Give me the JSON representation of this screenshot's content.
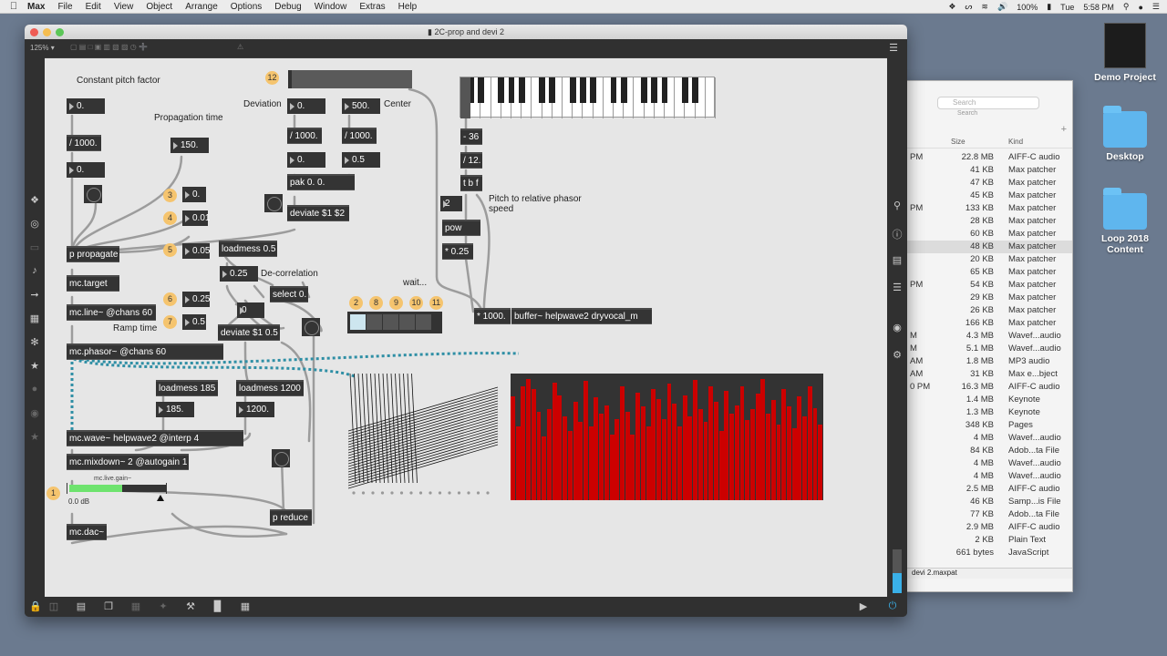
{
  "menubar": {
    "app": "Max",
    "items": [
      "File",
      "Edit",
      "View",
      "Object",
      "Arrange",
      "Options",
      "Debug",
      "Window",
      "Extras",
      "Help"
    ],
    "battery": "100%",
    "day": "Tue",
    "time": "5:58 PM"
  },
  "desktop": {
    "icons": [
      {
        "label": "Demo Project",
        "icon": "project-icon"
      },
      {
        "label": "Desktop",
        "icon": "folder-icon"
      },
      {
        "label": "Loop 2018 Content",
        "icon": "folder-icon"
      }
    ]
  },
  "finder": {
    "search_placeholder": "Search",
    "search_label": "Search",
    "columns": {
      "size": "Size",
      "kind": "Kind"
    },
    "rows": [
      {
        "date": "PM",
        "size": "22.8 MB",
        "kind": "AIFF-C audio"
      },
      {
        "date": "",
        "size": "41 KB",
        "kind": "Max patcher"
      },
      {
        "date": "",
        "size": "47 KB",
        "kind": "Max patcher"
      },
      {
        "date": "",
        "size": "45 KB",
        "kind": "Max patcher"
      },
      {
        "date": "PM",
        "size": "133 KB",
        "kind": "Max patcher"
      },
      {
        "date": "",
        "size": "28 KB",
        "kind": "Max patcher"
      },
      {
        "date": "",
        "size": "60 KB",
        "kind": "Max patcher"
      },
      {
        "date": "",
        "size": "48 KB",
        "kind": "Max patcher"
      },
      {
        "date": "",
        "size": "20 KB",
        "kind": "Max patcher"
      },
      {
        "date": "",
        "size": "65 KB",
        "kind": "Max patcher"
      },
      {
        "date": "PM",
        "size": "54 KB",
        "kind": "Max patcher"
      },
      {
        "date": "",
        "size": "29 KB",
        "kind": "Max patcher"
      },
      {
        "date": "",
        "size": "26 KB",
        "kind": "Max patcher"
      },
      {
        "date": "",
        "size": "166 KB",
        "kind": "Max patcher"
      },
      {
        "date": "M",
        "size": "4.3 MB",
        "kind": "Wavef...audio"
      },
      {
        "date": "M",
        "size": "5.1 MB",
        "kind": "Wavef...audio"
      },
      {
        "date": "AM",
        "size": "1.8 MB",
        "kind": "MP3 audio"
      },
      {
        "date": "AM",
        "size": "31 KB",
        "kind": "Max e...bject"
      },
      {
        "date": "0 PM",
        "size": "16.3 MB",
        "kind": "AIFF-C audio"
      },
      {
        "date": "",
        "size": "1.4 MB",
        "kind": "Keynote"
      },
      {
        "date": "",
        "size": "1.3 MB",
        "kind": "Keynote"
      },
      {
        "date": "",
        "size": "348 KB",
        "kind": "Pages"
      },
      {
        "date": "",
        "size": "4 MB",
        "kind": "Wavef...audio"
      },
      {
        "date": "",
        "size": "84 KB",
        "kind": "Adob...ta File"
      },
      {
        "date": "",
        "size": "4 MB",
        "kind": "Wavef...audio"
      },
      {
        "date": "",
        "size": "4 MB",
        "kind": "Wavef...audio"
      },
      {
        "date": "",
        "size": "2.5 MB",
        "kind": "AIFF-C audio"
      },
      {
        "date": "",
        "size": "46 KB",
        "kind": "Samp...is File"
      },
      {
        "date": "",
        "size": "77 KB",
        "kind": "Adob...ta File"
      },
      {
        "date": "",
        "size": "2.9 MB",
        "kind": "AIFF-C audio"
      },
      {
        "date": "",
        "size": "2 KB",
        "kind": "Plain Text"
      },
      {
        "date": "",
        "size": "661 bytes",
        "kind": "JavaScript"
      }
    ],
    "footer": "devi 2.maxpat"
  },
  "window": {
    "title": "2C-prop and devi 2",
    "zoom": "125%"
  },
  "patcher": {
    "comments": {
      "constant_pitch": "Constant pitch factor",
      "propagation": "Propagation time",
      "deviation": "Deviation",
      "center": "Center",
      "decorrelation": "De-correlation",
      "ramp_time": "Ramp time",
      "pitch_relative": "Pitch to relative phasor speed",
      "wait": "wait..."
    },
    "numbers": {
      "pitch_factor": "0.",
      "pitch_factor_out": "0.",
      "prop_time": "150.",
      "deviation": "0.",
      "center": "500.",
      "dev_scaled": "0.",
      "center_scaled": "0.5",
      "n3": "0.",
      "n4": "0.01",
      "n5": "0.05",
      "n_25a": "0.25",
      "n6": "0.25",
      "n7": "0.5",
      "n_zero": "0",
      "ramp185": "185.",
      "ramp1200": "1200.",
      "pow_base": "2"
    },
    "objects": {
      "div1000a": "/ 1000.",
      "div1000b": "/ 1000.",
      "div1000c": "/ 1000.",
      "pak": "pak 0. 0.",
      "deviate": "deviate $1 $2",
      "propagate": "p propagate",
      "target": "mc.target",
      "line": "mc.line~ @chans 60",
      "phasor": "mc.phasor~ @chans 60",
      "loadmess05": "loadmess 0.5",
      "select": "select 0.",
      "deviate05": "deviate $1 0.5",
      "loadmess185": "loadmess 185",
      "loadmess1200": "loadmess 1200",
      "wave": "mc.wave~ helpwave2 @interp 4",
      "mixdown": "mc.mixdown~ 2 @autogain 1",
      "dac": "mc.dac~",
      "reduce": "p reduce",
      "minus36": "- 36",
      "div12": "/ 12.",
      "tbf": "t b f",
      "pow": "pow",
      "mul025": "* 0.25",
      "mul1000": "* 1000.",
      "buffer": "buffer~ helpwave2 dryvocal_m"
    },
    "badges": [
      "12",
      "3",
      "4",
      "5",
      "6",
      "7",
      "1",
      "2",
      "8",
      "9",
      "10",
      "11"
    ],
    "gain": {
      "label": "mc.live.gain~",
      "value": "0.0 dB",
      "level": 0.55
    }
  },
  "colors": {
    "object_bg": "#343434",
    "canvas_bg": "#e6e6e6",
    "badge": "#f5c46e",
    "bars": "#cc0000",
    "mc_cord": "#2f8fa5"
  },
  "chart_data": {
    "type": "bar",
    "title": "",
    "series": [
      {
        "values": [
          0.82,
          0.58,
          0.9,
          0.96,
          0.88,
          0.7,
          0.5,
          0.72,
          0.93,
          0.83,
          0.66,
          0.55,
          0.78,
          0.62,
          0.94,
          0.58,
          0.81,
          0.68,
          0.75,
          0.52,
          0.64,
          0.9,
          0.7,
          0.52,
          0.85,
          0.74,
          0.58,
          0.88,
          0.8,
          0.64,
          0.92,
          0.76,
          0.58,
          0.83,
          0.66,
          0.95,
          0.72,
          0.62,
          0.9,
          0.78,
          0.55,
          0.86,
          0.68,
          0.75,
          0.9,
          0.63,
          0.72,
          0.84,
          0.96,
          0.68,
          0.79,
          0.6,
          0.88,
          0.74,
          0.57,
          0.82,
          0.66,
          0.9,
          0.73,
          0.6
        ]
      }
    ],
    "ylim": [
      0,
      1
    ]
  }
}
